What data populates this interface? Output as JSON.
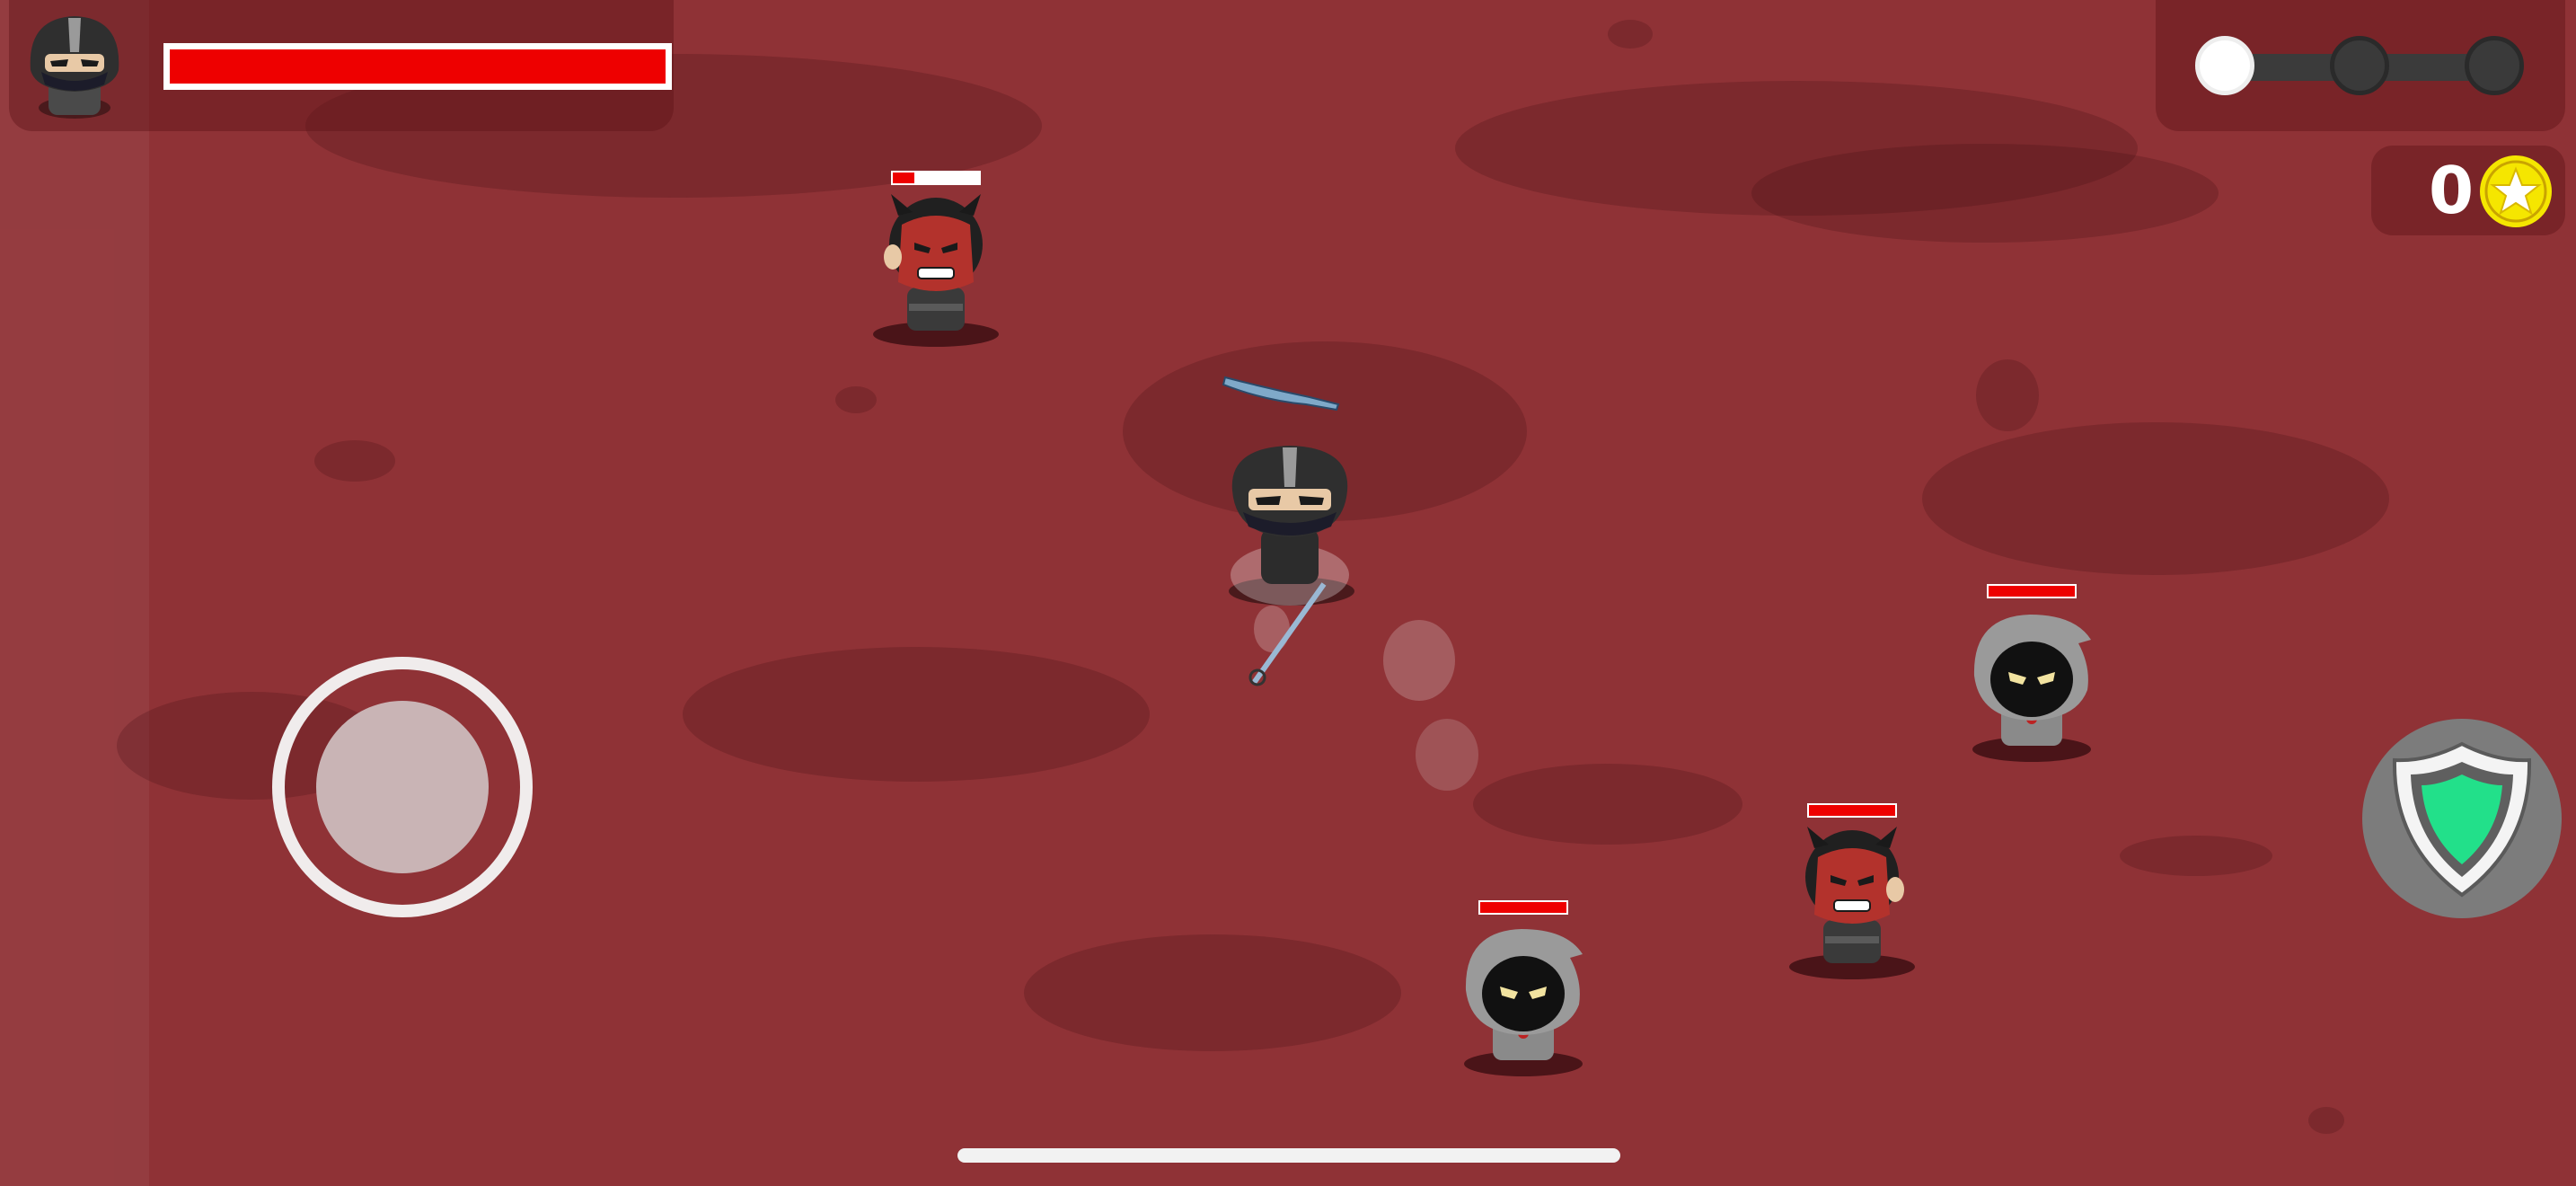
{
  "player": {
    "health_fraction": 1.0,
    "portrait_icon": "ninja-portrait"
  },
  "stage_progress": {
    "total_stages": 3,
    "completed_stages": 1,
    "done_color": "#ffffff",
    "pending_color": "#3a3a3a"
  },
  "coins": {
    "count": "0",
    "icon": "gold-star-coin-icon",
    "accent": "#f5e600"
  },
  "controls": {
    "joystick_icon": "virtual-joystick",
    "shield_icon": "shield-icon",
    "shield_color": "#22e08a"
  },
  "enemies": [
    {
      "kind": "red-demon",
      "health_fraction": 0.25
    },
    {
      "kind": "hooded-cultist",
      "health_fraction": 1.0
    },
    {
      "kind": "red-demon",
      "health_fraction": 1.0
    },
    {
      "kind": "hooded-cultist",
      "health_fraction": 1.0
    }
  ],
  "colors": {
    "ground": "#8f3236",
    "health": "#ee0000"
  }
}
